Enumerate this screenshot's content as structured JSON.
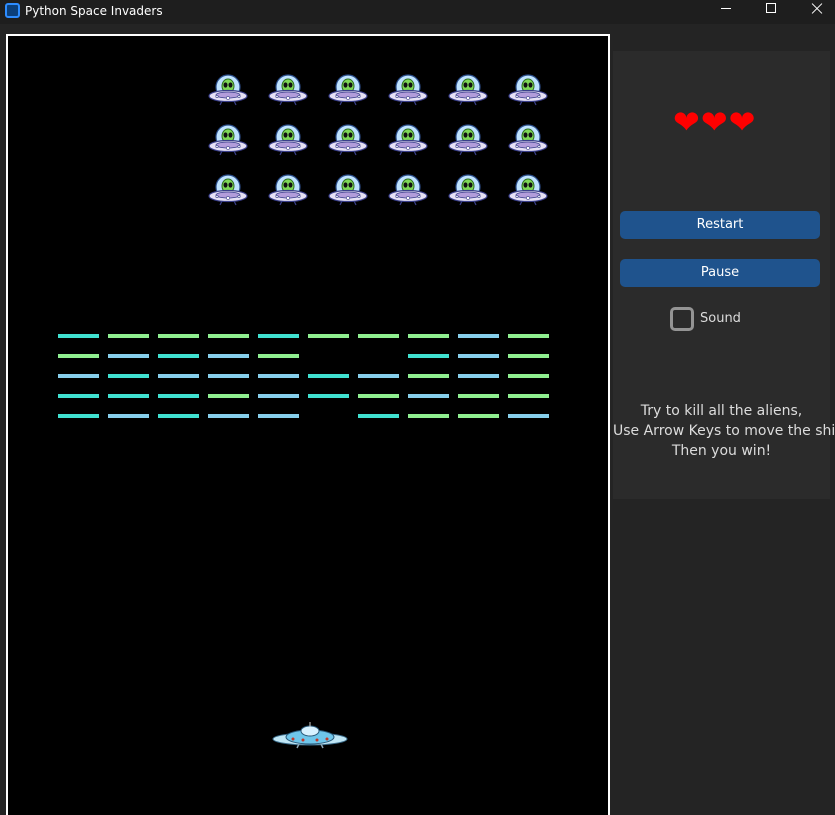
{
  "window": {
    "title": "Python Space Invaders",
    "controls": {
      "minimize_icon": "minimize-icon",
      "maximize_icon": "maximize-icon",
      "close_icon": "close-icon"
    }
  },
  "game": {
    "background_color": "#000000",
    "aliens": {
      "rows": 3,
      "columns": 6,
      "icon": "alien-ufo-icon"
    },
    "brick_colors": {
      "cyan": "#40e0d0",
      "green": "#90ee90",
      "blue": "#87ceeb"
    },
    "brick_rows": [
      [
        "cyan",
        "green",
        "green",
        "green",
        "cyan",
        "green",
        "green",
        "green",
        "blue",
        "green"
      ],
      [
        "green",
        "blue",
        "cyan",
        "blue",
        "green",
        null,
        null,
        "cyan",
        "blue",
        "green"
      ],
      [
        "blue",
        "cyan",
        "blue",
        "blue",
        "blue",
        "cyan",
        "blue",
        "green",
        "blue",
        "green"
      ],
      [
        "cyan",
        "cyan",
        "cyan",
        "green",
        "blue",
        "cyan",
        "green",
        "blue",
        "green",
        "green"
      ],
      [
        "cyan",
        "blue",
        "cyan",
        "blue",
        "blue",
        null,
        "cyan",
        "green",
        "green",
        "blue"
      ]
    ],
    "player": {
      "icon": "player-ship-icon"
    }
  },
  "panel": {
    "lives": "❤❤❤",
    "lives_count": 3,
    "restart_label": "Restart",
    "pause_label": "Pause",
    "sound_label": "Sound",
    "sound_checked": false,
    "instructions": [
      "Try to kill all the aliens,",
      "Use Arrow Keys to move the ship,",
      "Then you win!"
    ],
    "accent_color": "#1f538d",
    "heart_color": "#ff0000"
  }
}
